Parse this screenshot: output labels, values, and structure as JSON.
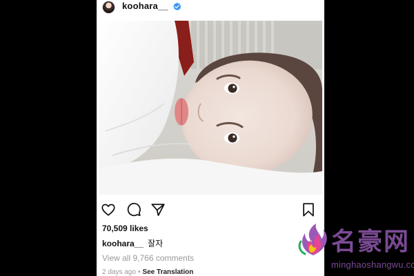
{
  "post": {
    "username": "koohara__",
    "verified": true,
    "likes": "70,509 likes",
    "caption_user": "koohara__",
    "caption_text": "잘자",
    "comments_link": "View all 9,766 comments",
    "time_ago": "2 days ago",
    "separator": "•",
    "see_translation": "See Translation"
  },
  "icons": {
    "like": "heart-icon",
    "comment": "comment-icon",
    "share": "send-icon",
    "save": "bookmark-icon",
    "verified": "verified-badge-icon"
  },
  "watermark": {
    "title": "名豪网",
    "url": "minghaoshangwu.com"
  },
  "colors": {
    "background": "#000000",
    "post_bg": "#ffffff",
    "text": "#111111",
    "muted": "#999999",
    "verified_blue": "#3897f0",
    "watermark_purple": "#7a4a93"
  }
}
